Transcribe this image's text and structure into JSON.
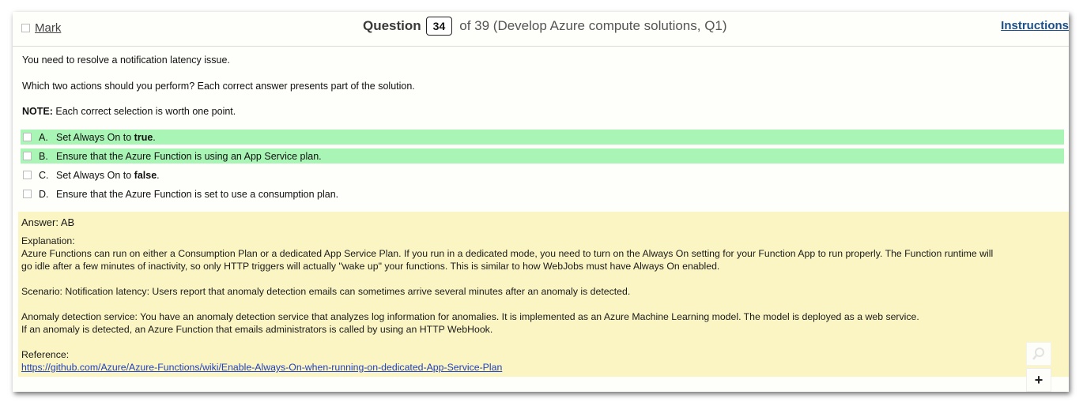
{
  "header": {
    "mark_label": "Mark",
    "question_word": "Question",
    "question_number": "34",
    "question_suffix": "of 39 (Develop Azure compute solutions, Q1)",
    "instructions_label": "Instructions"
  },
  "question": {
    "line1": "You need to resolve a notification latency issue.",
    "line2": "Which two actions should you perform? Each correct answer presents part of the solution.",
    "note_label": "NOTE:",
    "note_text": " Each correct selection is worth one point."
  },
  "options": [
    {
      "letter": "A.",
      "text_pre": "Set Always On to ",
      "text_bold": "true",
      "text_post": ".",
      "correct": true
    },
    {
      "letter": "B.",
      "text_pre": "Ensure that the Azure Function is using an App Service plan.",
      "text_bold": "",
      "text_post": "",
      "correct": true
    },
    {
      "letter": "C.",
      "text_pre": "Set Always On to ",
      "text_bold": "false",
      "text_post": ".",
      "correct": false
    },
    {
      "letter": "D.",
      "text_pre": "Ensure that the Azure Function is set to use a consumption plan.",
      "text_bold": "",
      "text_post": "",
      "correct": false
    }
  ],
  "answer": {
    "answer_line": "Answer: AB",
    "explanation_label": "Explanation:",
    "expl1": "Azure Functions can run on either a Consumption Plan or a dedicated App Service Plan. If you run in a dedicated mode, you need to turn on the Always On setting for your Function App to run properly. The Function runtime will",
    "expl2": "go idle after a few minutes of inactivity, so only HTTP triggers will actually \"wake up\" your functions. This is similar to how WebJobs must have Always On enabled.",
    "scenario": "Scenario: Notification latency: Users report that anomaly detection emails can sometimes arrive several minutes after an anomaly is detected.",
    "anomaly1": "Anomaly detection service: You have an anomaly detection service that analyzes log information for anomalies. It is implemented as an Azure Machine Learning model. The model is deployed as a web service.",
    "anomaly2": "If an anomaly is detected, an Azure Function that emails administrators is called by using an HTTP WebHook.",
    "reference_label": "Reference:",
    "reference_link": "https://github.com/Azure/Azure-Functions/wiki/Enable-Always-On-when-running-on-dedicated-App-Service-Plan"
  },
  "tools": {
    "zoom_icon": "magnifier-icon",
    "plus_icon": "plus-icon",
    "plus_glyph": "+"
  },
  "colors": {
    "correct_highlight": "#a9f5b5",
    "answer_background": "#fbf5c3",
    "link": "#1f3fbf"
  }
}
